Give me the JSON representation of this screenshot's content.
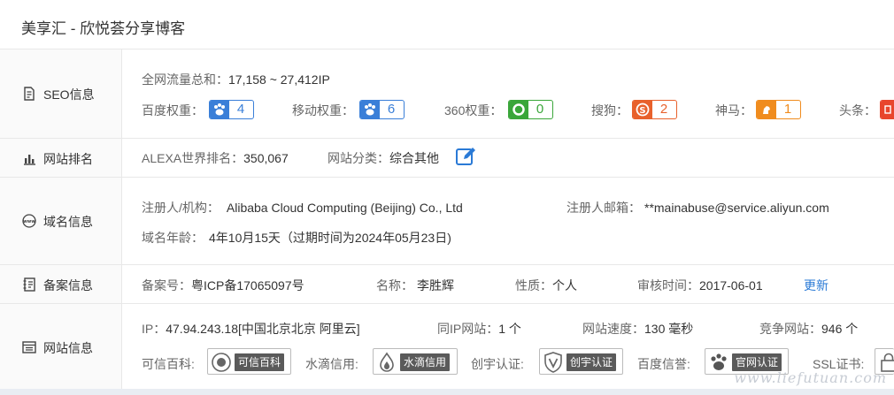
{
  "title": "美享汇 - 欣悦荟分享博客",
  "seo": {
    "label": "SEO信息",
    "traffic_label": "全网流量总和：",
    "traffic_value": "17,158 ~ 27,412IP",
    "weights": [
      {
        "label": "百度权重：",
        "value": "4",
        "color": "#3a7fd8",
        "icon": "paw-icon"
      },
      {
        "label": "移动权重：",
        "value": "6",
        "color": "#3a7fd8",
        "icon": "paw-icon"
      },
      {
        "label": "360权重：",
        "value": "0",
        "color": "#3aa63a",
        "icon": "ring-icon"
      },
      {
        "label": "搜狗：",
        "value": "2",
        "color": "#e8612c",
        "icon": "sogou-s-icon"
      },
      {
        "label": "神马：",
        "value": "1",
        "color": "#f08c1e",
        "icon": "horse-icon"
      },
      {
        "label": "头条：",
        "value": "",
        "color": "#e8452c",
        "icon": "toutiao-icon"
      }
    ]
  },
  "rank": {
    "label": "网站排名",
    "alexa_label": "ALEXA世界排名：",
    "alexa_value": "350,067",
    "category_label": "网站分类：",
    "category_value": "综合其他"
  },
  "domain": {
    "label": "域名信息",
    "registrant_label": "注册人/机构：",
    "registrant_value": "Alibaba Cloud Computing (Beijing) Co., Ltd",
    "email_label": "注册人邮箱：",
    "email_value": "**mainabuse@service.aliyun.com",
    "age_label": "域名年龄：",
    "age_value": "4年10月15天（过期时间为2024年05月23日)"
  },
  "icp": {
    "label": "备案信息",
    "number_label": "备案号：",
    "number_value": "粤ICP备17065097号",
    "name_label": "名称：",
    "name_value": "李胜辉",
    "nature_label": "性质：",
    "nature_value": "个人",
    "review_label": "审核时间：",
    "review_value": "2017-06-01",
    "update_link": "更新"
  },
  "site": {
    "label": "网站信息",
    "ip_label": "IP：",
    "ip_value": "47.94.243.18[中国北京北京 阿里云]",
    "same_ip_label": "同IP网站：",
    "same_ip_value": "1 个",
    "speed_label": "网站速度：",
    "speed_value": "130 毫秒",
    "compete_label": "竞争网站：",
    "compete_value": "946 个",
    "certs": [
      {
        "label": "可信百科:",
        "badge": "可信百科"
      },
      {
        "label": "水滴信用:",
        "badge": "水滴信用"
      },
      {
        "label": "创宇认证:",
        "badge": "创宇认证"
      },
      {
        "label": "百度信誉:",
        "badge": "官网认证"
      },
      {
        "label": "SSL证书:",
        "badge": ""
      }
    ]
  },
  "watermark": "www.liefutuan.com"
}
